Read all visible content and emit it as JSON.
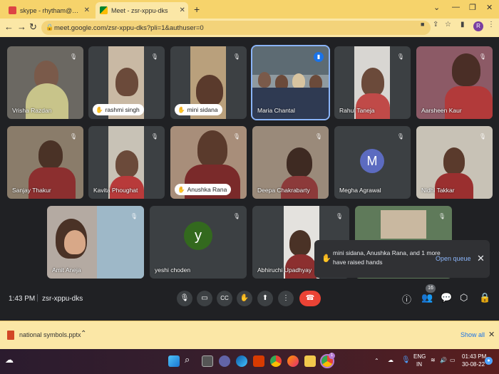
{
  "browser": {
    "tabs": [
      {
        "label": "skype - rhytham@theindianschool",
        "active": false
      },
      {
        "label": "Meet - zsr-xppu-dks",
        "active": true
      }
    ],
    "new_tab": "+",
    "url": "meet.google.com/zsr-xppu-dks?pli=1&authuser=0",
    "profile_initial": "R"
  },
  "participants": [
    {
      "name": "Vrisha Razdan",
      "muted": true,
      "hand": false
    },
    {
      "name": "rashmi singh",
      "muted": true,
      "hand": true
    },
    {
      "name": "mini sidana",
      "muted": true,
      "hand": true
    },
    {
      "name": "Maria Chantal",
      "muted": false,
      "hand": false,
      "speaking": true
    },
    {
      "name": "Rahul Taneja",
      "muted": true,
      "hand": false
    },
    {
      "name": "Aarsheen Kaur",
      "muted": true,
      "hand": false
    },
    {
      "name": "Sanjay Thakur",
      "muted": true,
      "hand": false
    },
    {
      "name": "Kavita Phoughat",
      "muted": true,
      "hand": false
    },
    {
      "name": "Anushka Rana",
      "muted": true,
      "hand": true
    },
    {
      "name": "Deepa Chakrabarty",
      "muted": true,
      "hand": false
    },
    {
      "name": "Megha Agrawal",
      "muted": true,
      "hand": false,
      "avatar": "M",
      "avatar_color": "#5c6bc0"
    },
    {
      "name": "Nidhi Takkar",
      "muted": true,
      "hand": false
    },
    {
      "name": "Amit Aneja",
      "muted": true,
      "hand": false
    },
    {
      "name": "yeshi choden",
      "muted": true,
      "hand": false,
      "avatar": "y",
      "avatar_color": "#33691e"
    },
    {
      "name": "Abhiruchi Upadhyay",
      "muted": true,
      "hand": false
    },
    {
      "name": "",
      "muted": true,
      "hand": false
    }
  ],
  "meeting": {
    "time": "1:43 PM",
    "code": "zsr-xppu-dks",
    "people_count": "16"
  },
  "notification": {
    "text": "mini sidana, Anushka Rana, and 1 more have raised hands",
    "action": "Open queue"
  },
  "downloads": {
    "file": "national symbols.pptx",
    "show_all": "Show all"
  },
  "taskbar": {
    "lang": "ENG",
    "region": "IN",
    "time": "01:43 PM",
    "date": "30-08-22",
    "chrome_badge": "1"
  }
}
